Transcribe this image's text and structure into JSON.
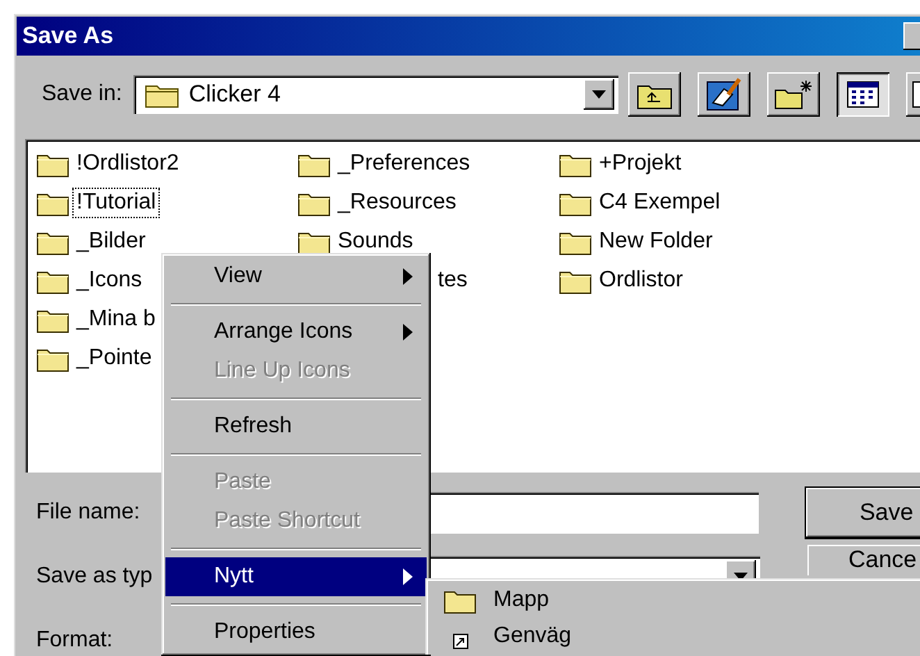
{
  "window": {
    "title": "Save As"
  },
  "save_in": {
    "label": "Save in:",
    "value": "Clicker 4"
  },
  "toolbar": [
    {
      "kind": "up"
    },
    {
      "kind": "desktop"
    },
    {
      "kind": "newfolder"
    },
    {
      "kind": "list",
      "selected": true
    },
    {
      "kind": "details",
      "selected": false
    }
  ],
  "file_list": {
    "columns": [
      {
        "items": [
          {
            "name": "!Ordlistor2",
            "kind": "folder",
            "focused": false
          },
          {
            "name": "!Tutorial",
            "kind": "folder",
            "focused": true
          },
          {
            "name": "_Bilder",
            "kind": "folder",
            "focused": false
          },
          {
            "name": "_Icons",
            "kind": "folder",
            "focused": false
          },
          {
            "name": "_Mina b",
            "kind": "folder",
            "focused": false
          },
          {
            "name": "_Pointe",
            "kind": "folder",
            "focused": false
          }
        ]
      },
      {
        "items": [
          {
            "name": "_Preferences",
            "kind": "folder",
            "focused": false
          },
          {
            "name": "_Resources",
            "kind": "folder",
            "focused": false
          },
          {
            "name": "Sounds",
            "kind": "folder",
            "focused": false
          },
          {
            "name": "tes",
            "kind": "covered",
            "focused": false
          }
        ]
      },
      {
        "items": [
          {
            "name": "+Projekt",
            "kind": "folder",
            "focused": false
          },
          {
            "name": "C4 Exempel",
            "kind": "folder",
            "focused": false
          },
          {
            "name": "New Folder",
            "kind": "folder",
            "focused": false
          },
          {
            "name": "Ordlistor",
            "kind": "folder",
            "focused": false
          }
        ]
      }
    ]
  },
  "fields": [
    {
      "label": "File name:",
      "kind": "text",
      "button": "Save"
    },
    {
      "label": "Save as typ",
      "kind": "combo",
      "button": "Cance"
    },
    {
      "label": "Format:",
      "kind": "none"
    }
  ],
  "context_menu": {
    "items": [
      {
        "kind": "item",
        "label": "View",
        "submenu": true,
        "disabled": false,
        "selected": false
      },
      {
        "kind": "separator"
      },
      {
        "kind": "item",
        "label": "Arrange Icons",
        "submenu": true,
        "disabled": false,
        "selected": false
      },
      {
        "kind": "item",
        "label": "Line Up Icons",
        "submenu": false,
        "disabled": true,
        "selected": false
      },
      {
        "kind": "separator"
      },
      {
        "kind": "item",
        "label": "Refresh",
        "submenu": false,
        "disabled": false,
        "selected": false
      },
      {
        "kind": "separator"
      },
      {
        "kind": "item",
        "label": "Paste",
        "submenu": false,
        "disabled": true,
        "selected": false
      },
      {
        "kind": "item",
        "label": "Paste Shortcut",
        "submenu": false,
        "disabled": true,
        "selected": false
      },
      {
        "kind": "separator"
      },
      {
        "kind": "item",
        "label": "Nytt",
        "submenu": true,
        "disabled": false,
        "selected": true
      },
      {
        "kind": "separator"
      },
      {
        "kind": "item",
        "label": "Properties",
        "submenu": false,
        "disabled": false,
        "selected": false
      }
    ]
  },
  "submenu": {
    "items": [
      {
        "label": "Mapp",
        "kind": "folder"
      },
      {
        "label": "Genväg",
        "kind": "shortcut"
      }
    ]
  }
}
